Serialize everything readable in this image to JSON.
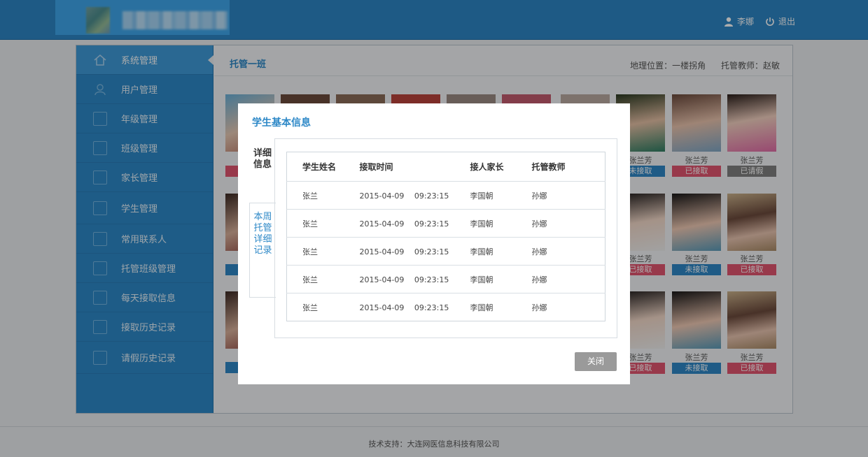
{
  "header": {
    "user_name": "李娜",
    "logout_label": "退出",
    "user_icon": "user-icon",
    "logout_icon": "power-icon"
  },
  "sidebar": {
    "items": [
      {
        "label": "系统管理",
        "icon": "home-icon",
        "active": true
      },
      {
        "label": "用户管理",
        "icon": "user-icon"
      },
      {
        "label": "年级管理",
        "icon": "document-icon"
      },
      {
        "label": "班级管理",
        "icon": "list-icon"
      },
      {
        "label": "家长管理",
        "icon": "contact-icon"
      },
      {
        "label": "学生管理",
        "icon": "student-icon"
      },
      {
        "label": "常用联系人",
        "icon": "chat-icon"
      },
      {
        "label": "托管班级管理",
        "icon": "grid-icon"
      },
      {
        "label": "每天接取信息",
        "icon": "edit-icon"
      },
      {
        "label": "接取历史记录",
        "icon": "history-icon"
      },
      {
        "label": "请假历史记录",
        "icon": "leave-icon"
      }
    ]
  },
  "content": {
    "class_title": "托管一班",
    "location": "地理位置：一楼拐角",
    "teacher": "托管教师：赵敏"
  },
  "students": {
    "caption": "张兰芳",
    "row1": [
      "未接取",
      "已接取",
      "已请假"
    ],
    "row2": [
      "已接取",
      "未接取",
      "已接取"
    ],
    "row3": [
      "已接取",
      "未接取",
      "已接取"
    ]
  },
  "modal": {
    "title": "学生基本信息",
    "tab_detail": "详细信息",
    "tab_week": "本周托管详细记录",
    "columns": [
      "学生姓名",
      "接取时间",
      "接人家长",
      "托管教师"
    ],
    "rows": [
      [
        "张兰",
        "2015-04-09　 09:23:15",
        "李国朝",
        "孙娜"
      ],
      [
        "张兰",
        "2015-04-09　 09:23:15",
        "李国朝",
        "孙娜"
      ],
      [
        "张兰",
        "2015-04-09　 09:23:15",
        "李国朝",
        "孙娜"
      ],
      [
        "张兰",
        "2015-04-09　 09:23:15",
        "李国朝",
        "孙娜"
      ],
      [
        "张兰",
        "2015-04-09　 09:23:15",
        "李国朝",
        "孙娜"
      ]
    ],
    "close_label": "关闭"
  },
  "footer": {
    "text": "技术支持：大连网医信息科技有限公司"
  },
  "colors": {
    "header_blue": "#2d85c4",
    "accent": "#2d88c7",
    "status_blue": "#2f86c6",
    "status_red": "#e0556f",
    "status_gray": "#7f7f7f"
  }
}
